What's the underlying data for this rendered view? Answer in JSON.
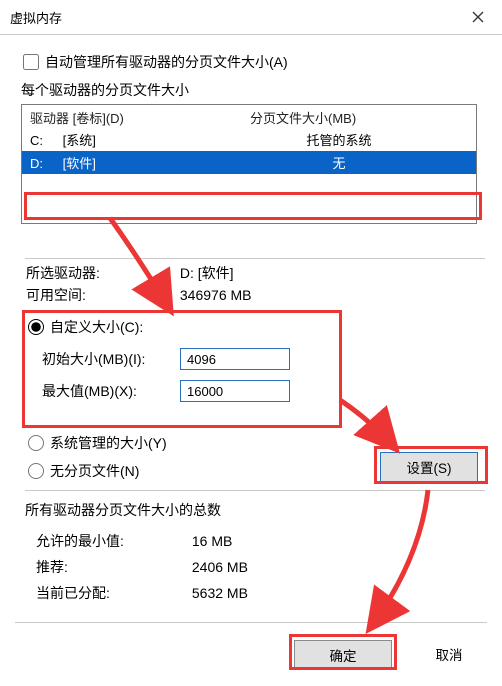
{
  "window": {
    "title": "虚拟内存",
    "close_label": "关闭"
  },
  "auto": {
    "label": "自动管理所有驱动器的分页文件大小(A)",
    "checked": false
  },
  "drives": {
    "caption": "每个驱动器的分页文件大小",
    "header": {
      "drive": "驱动器 [卷标](D)",
      "pf": "分页文件大小(MB)"
    },
    "rows": [
      {
        "letter": "C:",
        "volume": "[系统]",
        "pf": "托管的系统",
        "selected": false
      },
      {
        "letter": "D:",
        "volume": "[软件]",
        "pf": "无",
        "selected": true
      }
    ]
  },
  "selected_drive": {
    "drive_label": "所选驱动器:",
    "drive_value": "D:  [软件]",
    "space_label": "可用空间:",
    "space_value": "346976 MB"
  },
  "size": {
    "custom_label": "自定义大小(C):",
    "initial_label": "初始大小(MB)(I):",
    "initial_value": "4096",
    "max_label": "最大值(MB)(X):",
    "max_value": "16000",
    "system_label": "系统管理的大小(Y)",
    "none_label": "无分页文件(N)",
    "selected": "custom"
  },
  "set_button": "设置(S)",
  "totals": {
    "caption": "所有驱动器分页文件大小的总数",
    "min_label": "允许的最小值:",
    "min_value": "16 MB",
    "rec_label": "推荐:",
    "rec_value": "2406 MB",
    "cur_label": "当前已分配:",
    "cur_value": "5632 MB"
  },
  "footer": {
    "ok": "确定",
    "cancel": "取消"
  },
  "annotation_color": "#ec3636"
}
